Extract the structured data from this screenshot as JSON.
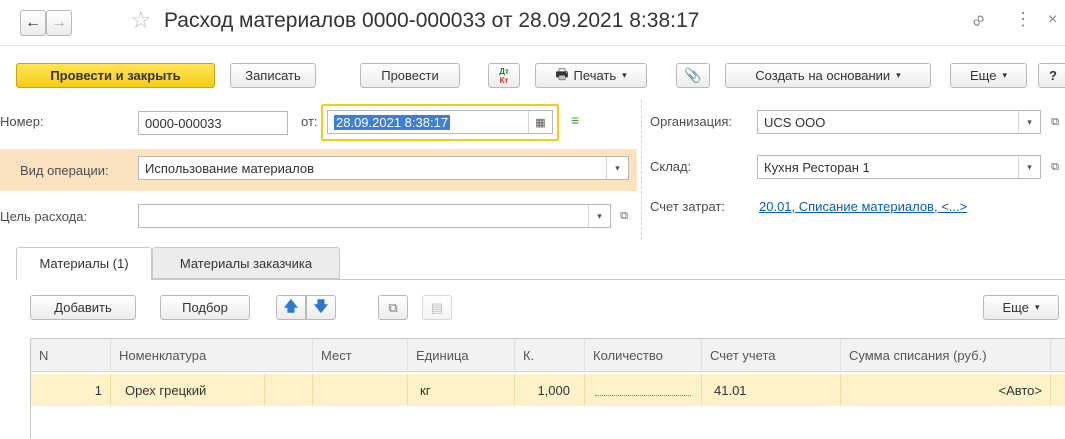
{
  "window": {
    "title": "Расход материалов 0000-000033 от 28.09.2021 8:38:17"
  },
  "toolbar": {
    "post_close_label": "Провести и закрыть",
    "save_label": "Записать",
    "post_label": "Провести",
    "dtkt_top": "Дт",
    "dtkt_bottom": "Кт",
    "print_label": "Печать",
    "create_based_label": "Создать на основании",
    "more_label": "Еще",
    "help_label": "?"
  },
  "form": {
    "number_label": "Номер:",
    "number_value": "0000-000033",
    "date_label": "от:",
    "date_value": "28.09.2021  8:38:17",
    "operation_label": "Вид операции:",
    "operation_value": "Использование материалов",
    "purpose_label": "Цель расхода:",
    "purpose_value": "",
    "org_label": "Организация:",
    "org_value": "UCS ООО",
    "warehouse_label": "Склад:",
    "warehouse_value": "Кухня Ресторан 1",
    "cost_account_label": "Счет затрат:",
    "cost_account_link": "20.01, Списание материалов, <...>"
  },
  "tabs": [
    {
      "label": "Материалы (1)",
      "active": true
    },
    {
      "label": "Материалы заказчика",
      "active": false
    }
  ],
  "table_toolbar": {
    "add_label": "Добавить",
    "select_label": "Подбор",
    "more_label": "Еще"
  },
  "table": {
    "columns": [
      "N",
      "Номенклатура",
      "Мест",
      "Единица",
      "К.",
      "Количество",
      "Счет учета",
      "Сумма списания (руб.)"
    ],
    "rows": [
      {
        "n": "1",
        "item": "Орех грецкий",
        "places": "",
        "unit": "кг",
        "k": "1,000",
        "qty": "",
        "account": "41.01",
        "sum": "<Авто>"
      }
    ]
  },
  "colors": {
    "accent_yellow": "#f5cc17",
    "row_highlight": "#fdf2c8",
    "operation_band": "#fbe3c0",
    "link_blue": "#0b5fbf"
  }
}
